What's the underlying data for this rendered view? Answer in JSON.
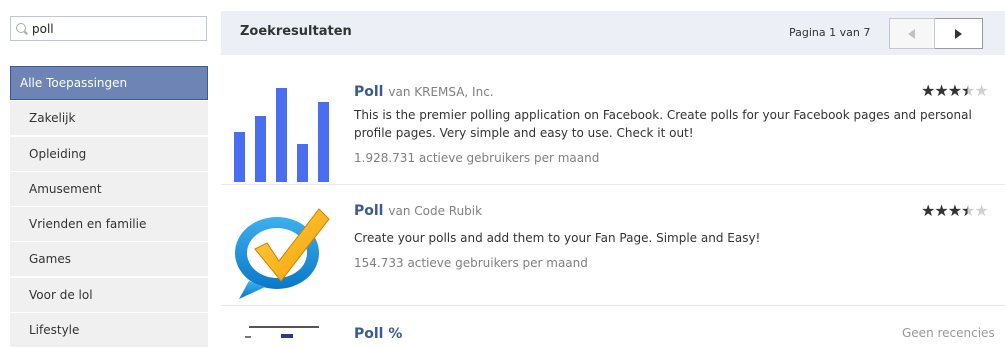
{
  "search": {
    "value": "poll"
  },
  "sidebar": {
    "items": [
      {
        "label": "Alle Toepassingen",
        "active": true
      },
      {
        "label": "Zakelijk"
      },
      {
        "label": "Opleiding"
      },
      {
        "label": "Amusement"
      },
      {
        "label": "Vrienden en familie"
      },
      {
        "label": "Games"
      },
      {
        "label": "Voor de lol"
      },
      {
        "label": "Lifestyle"
      }
    ]
  },
  "header": {
    "title": "Zoekresultaten",
    "page_info": "Pagina 1 van 7",
    "prev_icon": "chevron-left-icon",
    "next_icon": "chevron-right-icon"
  },
  "results": [
    {
      "name": "Poll",
      "developer": "van KREMSA, Inc.",
      "description": "This is the premier polling application on Facebook. Create polls for your Facebook pages and personal profile pages. Very simple and easy to use. Check it out!",
      "users": "1.928.731 actieve gebruikers per maand",
      "rating": 3.5,
      "icon": "bar-chart-icon"
    },
    {
      "name": "Poll",
      "developer": "van Code Rubik",
      "description": "Create your polls and add them to your Fan Page. Simple and Easy!",
      "users": "154.733 actieve gebruikers per maand",
      "rating": 3.5,
      "icon": "checkmark-bubble-icon"
    },
    {
      "name": "Poll %",
      "status": "Geen recencies",
      "icon": "document-thumbnail-icon"
    }
  ],
  "colors": {
    "accent": "#3b5998",
    "active_nav": "#6d84b4",
    "bar_icon": "#4a6ef0"
  }
}
